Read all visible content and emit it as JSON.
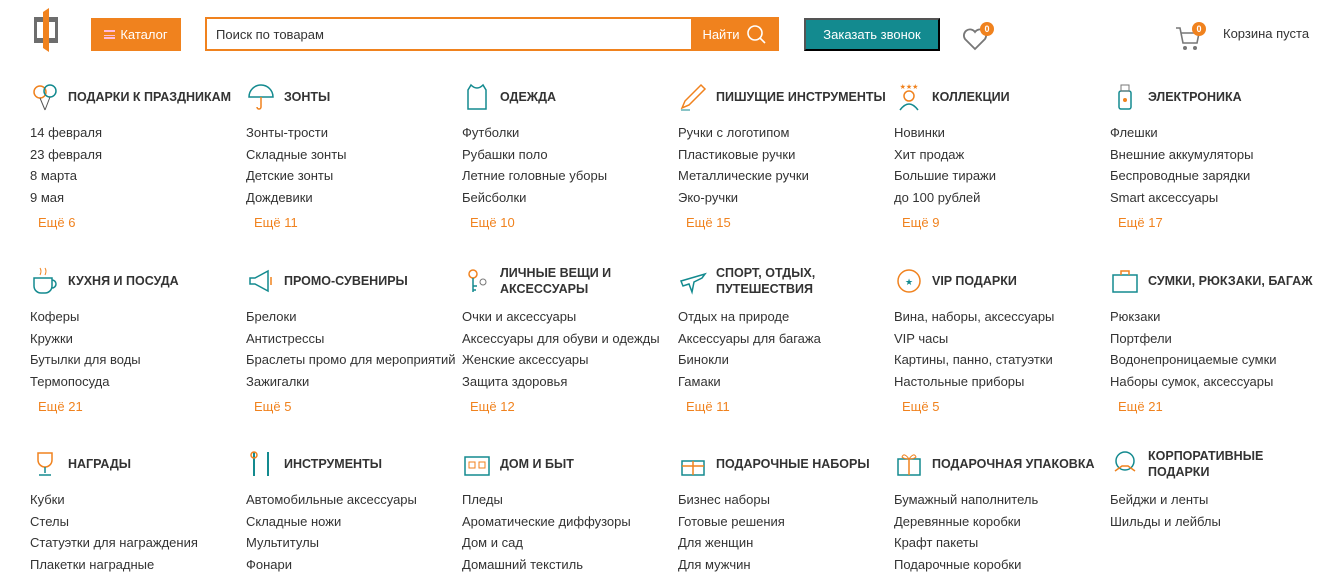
{
  "header": {
    "catalog_label": "Каталог",
    "search_placeholder": "Поиск по товарам",
    "search_button": "Найти",
    "call_button": "Заказать звонок",
    "favorites_count": "0",
    "cart_count": "0",
    "cart_label": "Корзина пуста"
  },
  "colors": {
    "accent": "#f0821e",
    "teal": "#138a8f"
  },
  "rows": [
    [
      {
        "title": "Подарки к праздникам",
        "icon": "balloons-icon",
        "items": [
          "14 февраля",
          "23 февраля",
          "8 марта",
          "9 мая"
        ],
        "more": "Ещё 6"
      },
      {
        "title": "Зонты",
        "icon": "umbrella-icon",
        "items": [
          "Зонты-трости",
          "Складные зонты",
          "Детские зонты",
          "Дождевики"
        ],
        "more": "Ещё 11"
      },
      {
        "title": "Одежда",
        "icon": "shirt-icon",
        "items": [
          "Футболки",
          "Рубашки поло",
          "Летние головные уборы",
          "Бейсболки"
        ],
        "more": "Ещё 10"
      },
      {
        "title": "Пишущие инструменты",
        "icon": "pen-icon",
        "items": [
          "Ручки с логотипом",
          "Пластиковые ручки",
          "Металлические ручки",
          "Эко-ручки"
        ],
        "more": "Ещё 15"
      },
      {
        "title": "Коллекции",
        "icon": "star-person-icon",
        "items": [
          "Новинки",
          "Хит продаж",
          "Большие тиражи",
          "до 100 рублей"
        ],
        "more": "Ещё 9"
      },
      {
        "title": "Электроника",
        "icon": "flash-drive-icon",
        "items": [
          "Флешки",
          "Внешние аккумуляторы",
          "Беспроводные зарядки",
          "Smart аксессуары"
        ],
        "more": "Ещё 17"
      }
    ],
    [
      {
        "title": "Кухня и посуда",
        "icon": "cup-icon",
        "items": [
          "Коферы",
          "Кружки",
          "Бутылки для воды",
          "Термопосуда"
        ],
        "more": "Ещё 21"
      },
      {
        "title": "Промо-сувениры",
        "icon": "megaphone-icon",
        "items": [
          "Брелоки",
          "Антистрессы",
          "Браслеты промо для мероприятий",
          "Зажигалки"
        ],
        "more": "Ещё 5"
      },
      {
        "title": "Личные вещи и аксессуары",
        "icon": "keys-icon",
        "items": [
          "Очки и аксессуары",
          "Аксессуары для обуви и одежды",
          "Женские аксессуары",
          "Защита здоровья"
        ],
        "more": "Ещё 12"
      },
      {
        "title": "Спорт, отдых, путешествия",
        "icon": "plane-icon",
        "items": [
          "Отдых на природе",
          "Аксессуары для багажа",
          "Бинокли",
          "Гамаки"
        ],
        "more": "Ещё 11"
      },
      {
        "title": "VIP подарки",
        "icon": "vip-badge-icon",
        "items": [
          "Вина, наборы, аксессуары",
          "VIP часы",
          "Картины, панно, статуэтки",
          "Настольные приборы"
        ],
        "more": "Ещё 5"
      },
      {
        "title": "Сумки, рюкзаки, багаж",
        "icon": "bag-icon",
        "items": [
          "Рюкзаки",
          "Портфели",
          "Водонепроницаемые сумки",
          "Наборы сумок, аксессуары"
        ],
        "more": "Ещё 21"
      }
    ],
    [
      {
        "title": "Награды",
        "icon": "trophy-icon",
        "items": [
          "Кубки",
          "Стелы",
          "Статуэтки для награждения",
          "Плакетки наградные"
        ]
      },
      {
        "title": "Инструменты",
        "icon": "tools-icon",
        "items": [
          "Автомобильные аксессуары",
          "Складные ножи",
          "Мультитулы",
          "Фонари"
        ]
      },
      {
        "title": "Дом и быт",
        "icon": "house-icon",
        "items": [
          "Пледы",
          "Ароматические диффузоры",
          "Дом и сад",
          "Домашний текстиль"
        ]
      },
      {
        "title": "Подарочные наборы",
        "icon": "gift-set-icon",
        "items": [
          "Бизнес наборы",
          "Готовые решения",
          "Для женщин",
          "Для мужчин"
        ]
      },
      {
        "title": "Подарочная упаковка",
        "icon": "gift-box-icon",
        "items": [
          "Бумажный наполнитель",
          "Деревянные коробки",
          "Крафт пакеты",
          "Подарочные коробки"
        ]
      },
      {
        "title": "Корпоративные подарки",
        "icon": "handshake-icon",
        "items": [
          "Бейджи и ленты",
          "Шильды и лейблы"
        ]
      }
    ]
  ]
}
